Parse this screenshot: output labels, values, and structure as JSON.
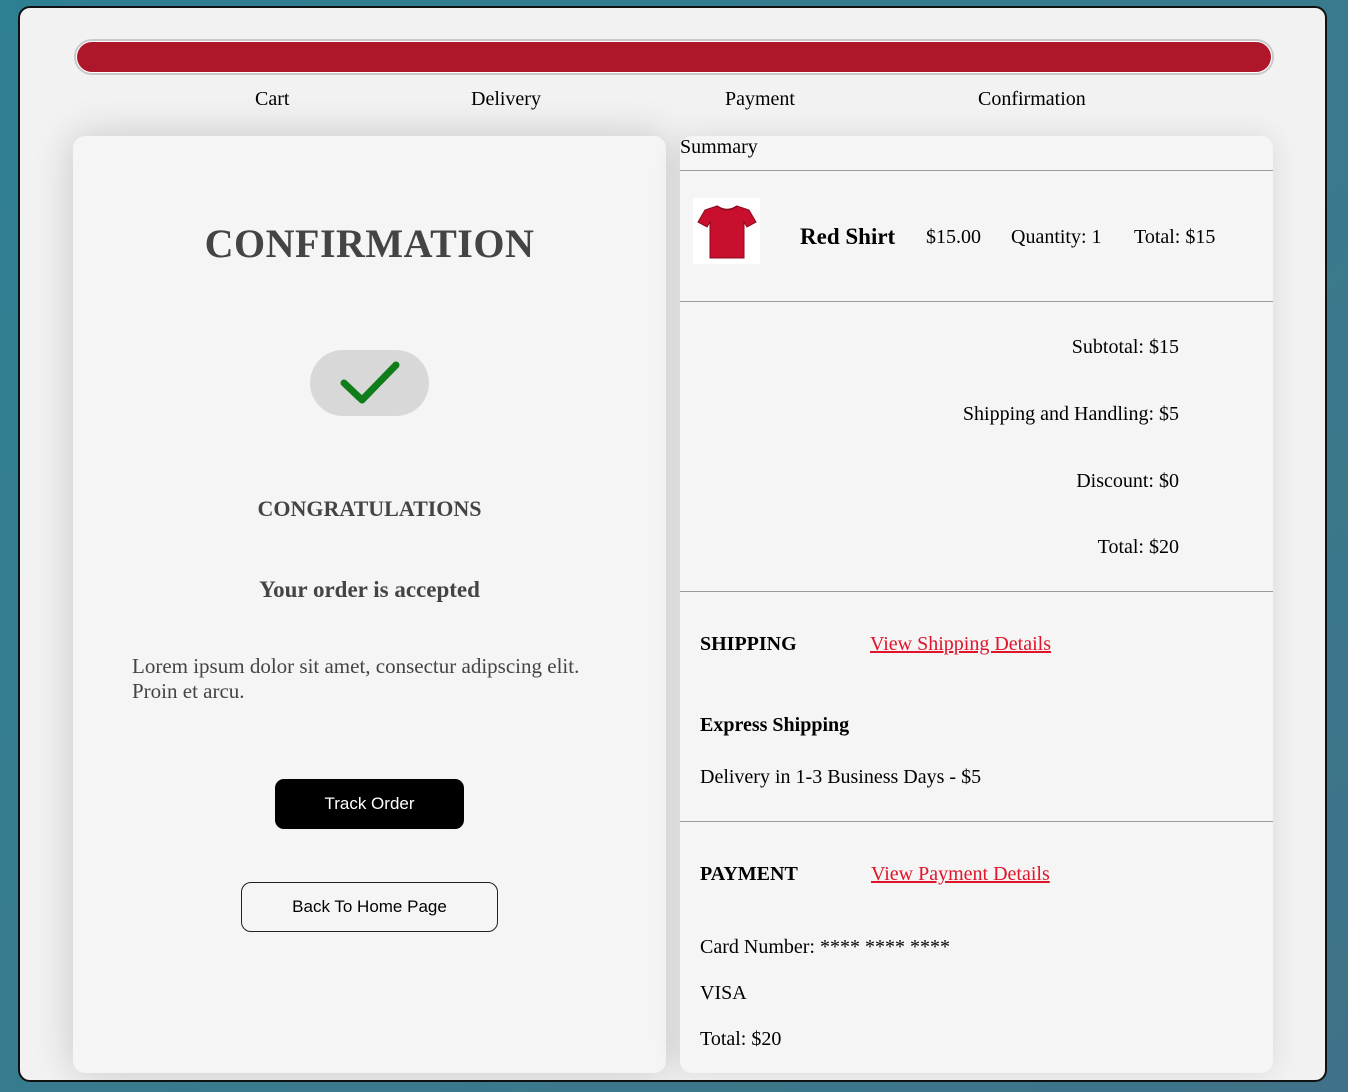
{
  "steps": [
    "Cart",
    "Delivery",
    "Payment",
    "Confirmation"
  ],
  "progress_fraction": 1.0,
  "colors": {
    "accent": "#ae1629",
    "link": "#e0142a",
    "check": "#0f7d1a"
  },
  "confirmation": {
    "title": "CONFIRMATION",
    "congrats": "CONGRATULATIONS",
    "accepted": "Your order is accepted",
    "message": "Lorem ipsum dolor sit amet, consectur adipscing elit. Proin et arcu.",
    "track_button": "Track Order",
    "home_button": "Back To Home Page"
  },
  "summary": {
    "label": "Summary",
    "item": {
      "name": "Red Shirt",
      "price": "$15.00",
      "quantity": "Quantity: 1",
      "total": "Total: $15",
      "image_icon": "red-shirt-icon"
    },
    "subtotal": "Subtotal: $15",
    "shipping_handling": "Shipping and Handling: $5",
    "discount": "Discount: $0",
    "total": "Total: $20",
    "shipping": {
      "title": "SHIPPING",
      "link": "View Shipping Details",
      "method": "Express Shipping",
      "detail": "Delivery in 1-3 Business Days - $5"
    },
    "payment": {
      "title": "PAYMENT",
      "link": "View Payment Details",
      "card_number": "Card Number: **** **** ****",
      "card_type": "VISA",
      "total": "Total: $20"
    }
  }
}
